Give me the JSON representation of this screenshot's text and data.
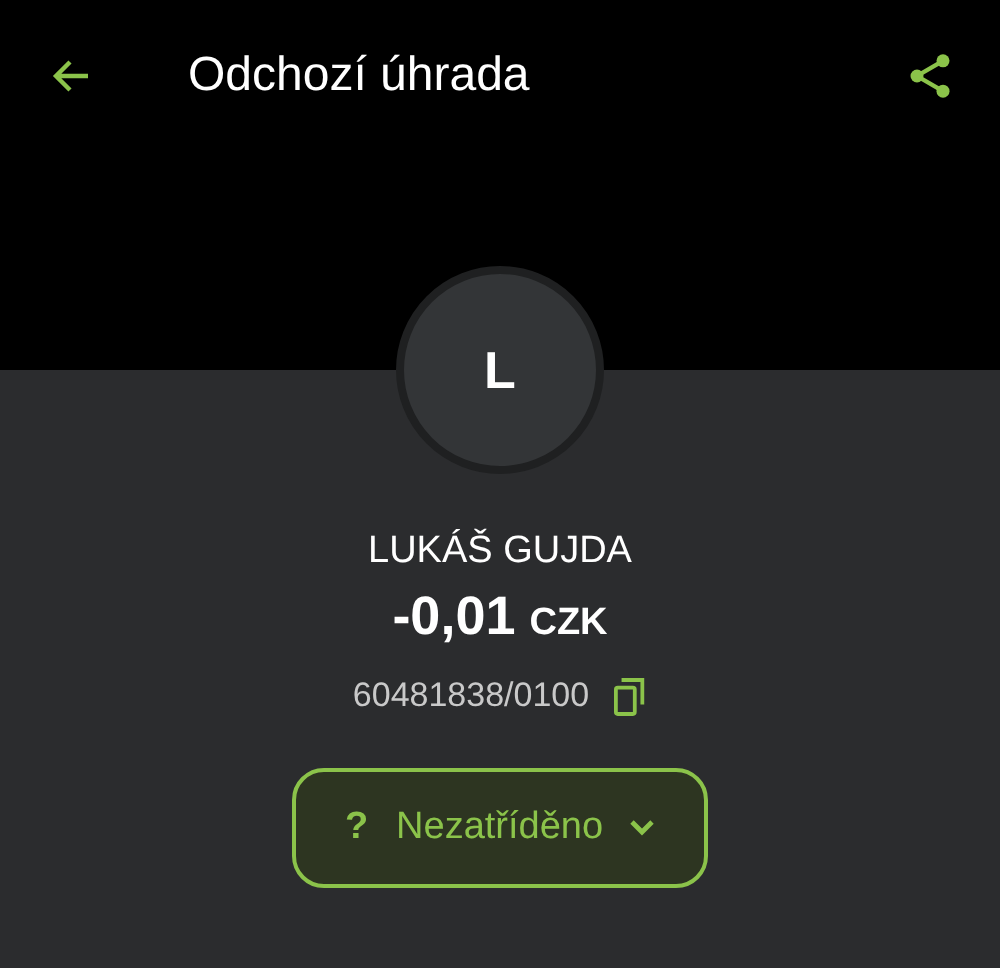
{
  "header": {
    "title": "Odchozí úhrada"
  },
  "avatar": {
    "initial": "L"
  },
  "payee": {
    "name": "LUKÁŠ GUJDA",
    "amount": "-0,01",
    "currency": "CZK",
    "account": "60481838/0100"
  },
  "category": {
    "icon": "?",
    "label": "Nezatříděno"
  }
}
